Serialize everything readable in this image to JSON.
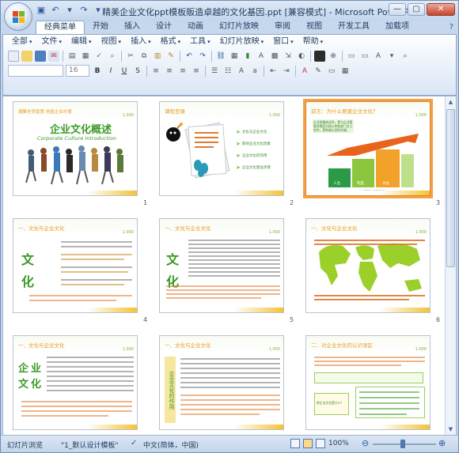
{
  "window": {
    "title": "精美企业文化ppt模板販造卓越的文化基因.ppt [兼容模式] - Microsoft PowerPoint",
    "controls": [
      "—",
      "▢",
      "✕"
    ]
  },
  "tabs": [
    "经典菜单",
    "开始",
    "插入",
    "设计",
    "动画",
    "幻灯片放映",
    "审阅",
    "视图",
    "开发工具",
    "加载项"
  ],
  "active_tab_index": 0,
  "menus": [
    "全部",
    "文件",
    "编辑",
    "视图",
    "插入",
    "格式",
    "工具",
    "幻灯片放映",
    "窗口",
    "帮助"
  ],
  "font_size_value": "16",
  "slides": [
    {
      "number": "1",
      "header": "凝聚全员智慧 创造企业价值",
      "title": "企业文化概述",
      "subtitle": "Corporate Culture Introduction"
    },
    {
      "number": "2",
      "header": "课程目录",
      "items": [
        "文化与企业文化",
        "影响企业文化因素",
        "企业文化的作用",
        "企业文化建设步骤"
      ]
    },
    {
      "number": "3",
      "header": "前言：为什么要建企业文化？",
      "intro": "企业的整体运作，是与企业管理决策层为核心的各部门分工合作，是和谐与否的关键。",
      "steps": [
        "人治",
        "制度",
        "文化"
      ],
      "caption": "企业管理 发展历程"
    },
    {
      "number": "4",
      "header": "一、文化与企业文化",
      "chars": [
        "文",
        "化"
      ]
    },
    {
      "number": "5",
      "header": "一、文化与企业文化",
      "chars": [
        "文",
        "化"
      ]
    },
    {
      "number": "6",
      "header": "一、文化与企业文化"
    },
    {
      "number": "7",
      "header": "一、文化与企业文化",
      "chars": [
        "企",
        "业",
        "文",
        "化"
      ]
    },
    {
      "number": "8",
      "header": "一、文化与企业文化",
      "vertical": "企业文化的作用"
    },
    {
      "number": "9",
      "header": "二、对企业文化的认识误区",
      "box_question": "那企业文化是什么？",
      "box_text": "认为企业文化就是..."
    }
  ],
  "brand_tag": "1.000",
  "status": {
    "view": "幻灯片浏览",
    "theme": "\"1_默认设计模板\"",
    "language": "中文(简体，中国)",
    "zoom": "100%"
  }
}
